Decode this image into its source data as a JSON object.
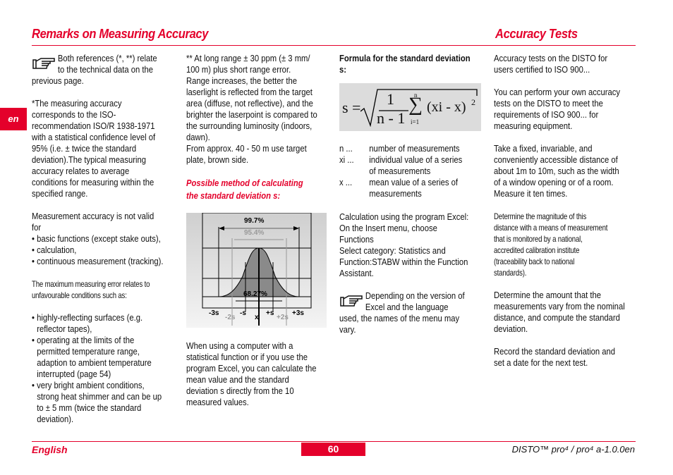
{
  "header": {
    "left_title": "Remarks on Measuring Accuracy",
    "right_title": "Accuracy Tests"
  },
  "lang_tab": "en",
  "columns": {
    "col1": {
      "lines": [
        {
          "t": "Both references  (*, **) relate",
          "note": true
        },
        {
          "t": "to the technical data on the",
          "note": true
        },
        {
          "t": "previous page."
        },
        {
          "t": ""
        },
        {
          "t": "*The measuring accuracy"
        },
        {
          "t": "corresponds to the ISO-"
        },
        {
          "t": "recommendation ISO/R 1938-1971"
        },
        {
          "t": "with a statistical confidence level of"
        },
        {
          "t": "95% (i.e. ±  twice the standard"
        },
        {
          "t": "deviation).The typical measuring"
        },
        {
          "t": "accuracy relates to average"
        },
        {
          "t": "conditions for measuring within the"
        },
        {
          "t": "specified range."
        },
        {
          "t": ""
        },
        {
          "t": "Measurement accuracy is not valid"
        },
        {
          "t": "for"
        },
        {
          "t": "• basic functions (except stake outs),"
        },
        {
          "t": "• calculation,"
        },
        {
          "t": "• continuous measurement (tracking)."
        },
        {
          "t": ""
        },
        {
          "t": "The maximum measuring error relates to",
          "small": true
        },
        {
          "t": "unfavourable conditions such as:",
          "small": true
        },
        {
          "t": ""
        },
        {
          "t": "•  highly-reflecting surfaces (e.g."
        },
        {
          "t": "reflector tapes),",
          "ind": true
        },
        {
          "t": "•  operating at  the limits of the"
        },
        {
          "t": "permitted temperature range,",
          "ind": true
        },
        {
          "t": "adaption to ambient temperature",
          "ind": true
        },
        {
          "t": "interrupted (page 54)",
          "ind": true
        },
        {
          "t": "•  very bright ambient conditions,"
        },
        {
          "t": "strong heat shimmer and can be up",
          "ind": true
        },
        {
          "t": "to  ± 5 mm (twice the standard",
          "ind": true
        },
        {
          "t": "deviation).",
          "ind": true
        }
      ]
    },
    "col2a": {
      "lines": [
        {
          "t": "** At long range ± 30 ppm (± 3 mm/"
        },
        {
          "t": "100 m) plus short range error."
        },
        {
          "t": "Range increases, the better the"
        },
        {
          "t": "laserlight is reflected from the target"
        },
        {
          "t": "area (diffuse, not reflective), and the"
        },
        {
          "t": "brighter the laserpoint is compared to"
        },
        {
          "t": "the surrounding luminosity (indoors,"
        },
        {
          "t": "dawn)."
        },
        {
          "t": "From approx. 40 - 50 m use target"
        },
        {
          "t": "plate, brown side."
        }
      ]
    },
    "col2_heading": [
      "Possible method of calculating",
      "the standard deviation s:"
    ],
    "col2b": {
      "lines": [
        {
          "t": "When using a computer with a"
        },
        {
          "t": "statistical function or if you use the"
        },
        {
          "t": "program Excel, you can calculate the"
        },
        {
          "t": "mean value       and the standard"
        },
        {
          "t": "deviation s directly from the 10"
        },
        {
          "t": "measured values."
        }
      ]
    },
    "col3_heading": [
      "Formula for the standard deviation",
      "s:"
    ],
    "legend": [
      {
        "sym": "n ...",
        "desc": [
          "number of measurements"
        ]
      },
      {
        "sym": "xi ...",
        "desc": [
          "individual value of a series",
          "of measurements"
        ]
      },
      {
        "sym": "x ...",
        "desc": [
          "mean value of a series of",
          "measurements"
        ]
      }
    ],
    "col3b": {
      "lines": [
        {
          "t": "Calculation using the program Excel:"
        },
        {
          "t": "On the Insert menu, choose"
        },
        {
          "t": "Functions"
        },
        {
          "t": "Select category: Statistics and"
        },
        {
          "t": "Function:STABW within the Function"
        },
        {
          "t": "Assistant."
        }
      ]
    },
    "col3c": {
      "lines": [
        {
          "t": "Depending on the version of",
          "note": true
        },
        {
          "t": "Excel and the language",
          "note": true
        },
        {
          "t": "used, the names of the menu may"
        },
        {
          "t": "vary."
        }
      ]
    },
    "col4": {
      "lines": [
        {
          "t": "Accuracy tests on the DISTO for"
        },
        {
          "t": "users certified to ISO 900..."
        },
        {
          "t": ""
        },
        {
          "t": "You can perform your own accuracy"
        },
        {
          "t": "tests on the DISTO to meet the"
        },
        {
          "t": "requirements of ISO 900... for"
        },
        {
          "t": "measuring equipment."
        },
        {
          "t": ""
        },
        {
          "t": "Take a fixed, invariable, and"
        },
        {
          "t": "conveniently accessible distance of"
        },
        {
          "t": "about 1m to 10m, such as the width"
        },
        {
          "t": "of a window opening or of a room."
        },
        {
          "t": "Measure it ten times."
        },
        {
          "t": ""
        },
        {
          "t": "Determine the magnitude of this",
          "small": true
        },
        {
          "t": "distance with a means of measurement",
          "small": true
        },
        {
          "t": "that is monitored by a national,",
          "small": true
        },
        {
          "t": "accredited calibration institute",
          "small": true
        },
        {
          "t": "(traceability back to national",
          "small": true
        },
        {
          "t": "standards).",
          "small": true
        },
        {
          "t": ""
        },
        {
          "t": "Determine the amount that the"
        },
        {
          "t": "measurements vary from the nominal"
        },
        {
          "t": "distance, and compute the standard"
        },
        {
          "t": "deviation."
        },
        {
          "t": ""
        },
        {
          "t": "Record the standard deviation and"
        },
        {
          "t": "set a date for the next test."
        }
      ]
    }
  },
  "formula": {
    "lhs": "s =",
    "num": "1",
    "den": "n - 1",
    "sum_top": "n",
    "sum_bottom": "i=1",
    "term": "(xi - x)",
    "exp": "2"
  },
  "diagram": {
    "p997": "99.7%",
    "p954": "95.4%",
    "p6827": "68.27%",
    "labels": [
      "-3s",
      "-2s",
      "-s",
      "x",
      "+s",
      "+2s",
      "+3s"
    ]
  },
  "footer": {
    "language": "English",
    "page": "60",
    "doc": "DISTO™ pro⁴ / pro⁴ a-1.0.0en"
  },
  "colors": {
    "accent": "#e4002b"
  }
}
